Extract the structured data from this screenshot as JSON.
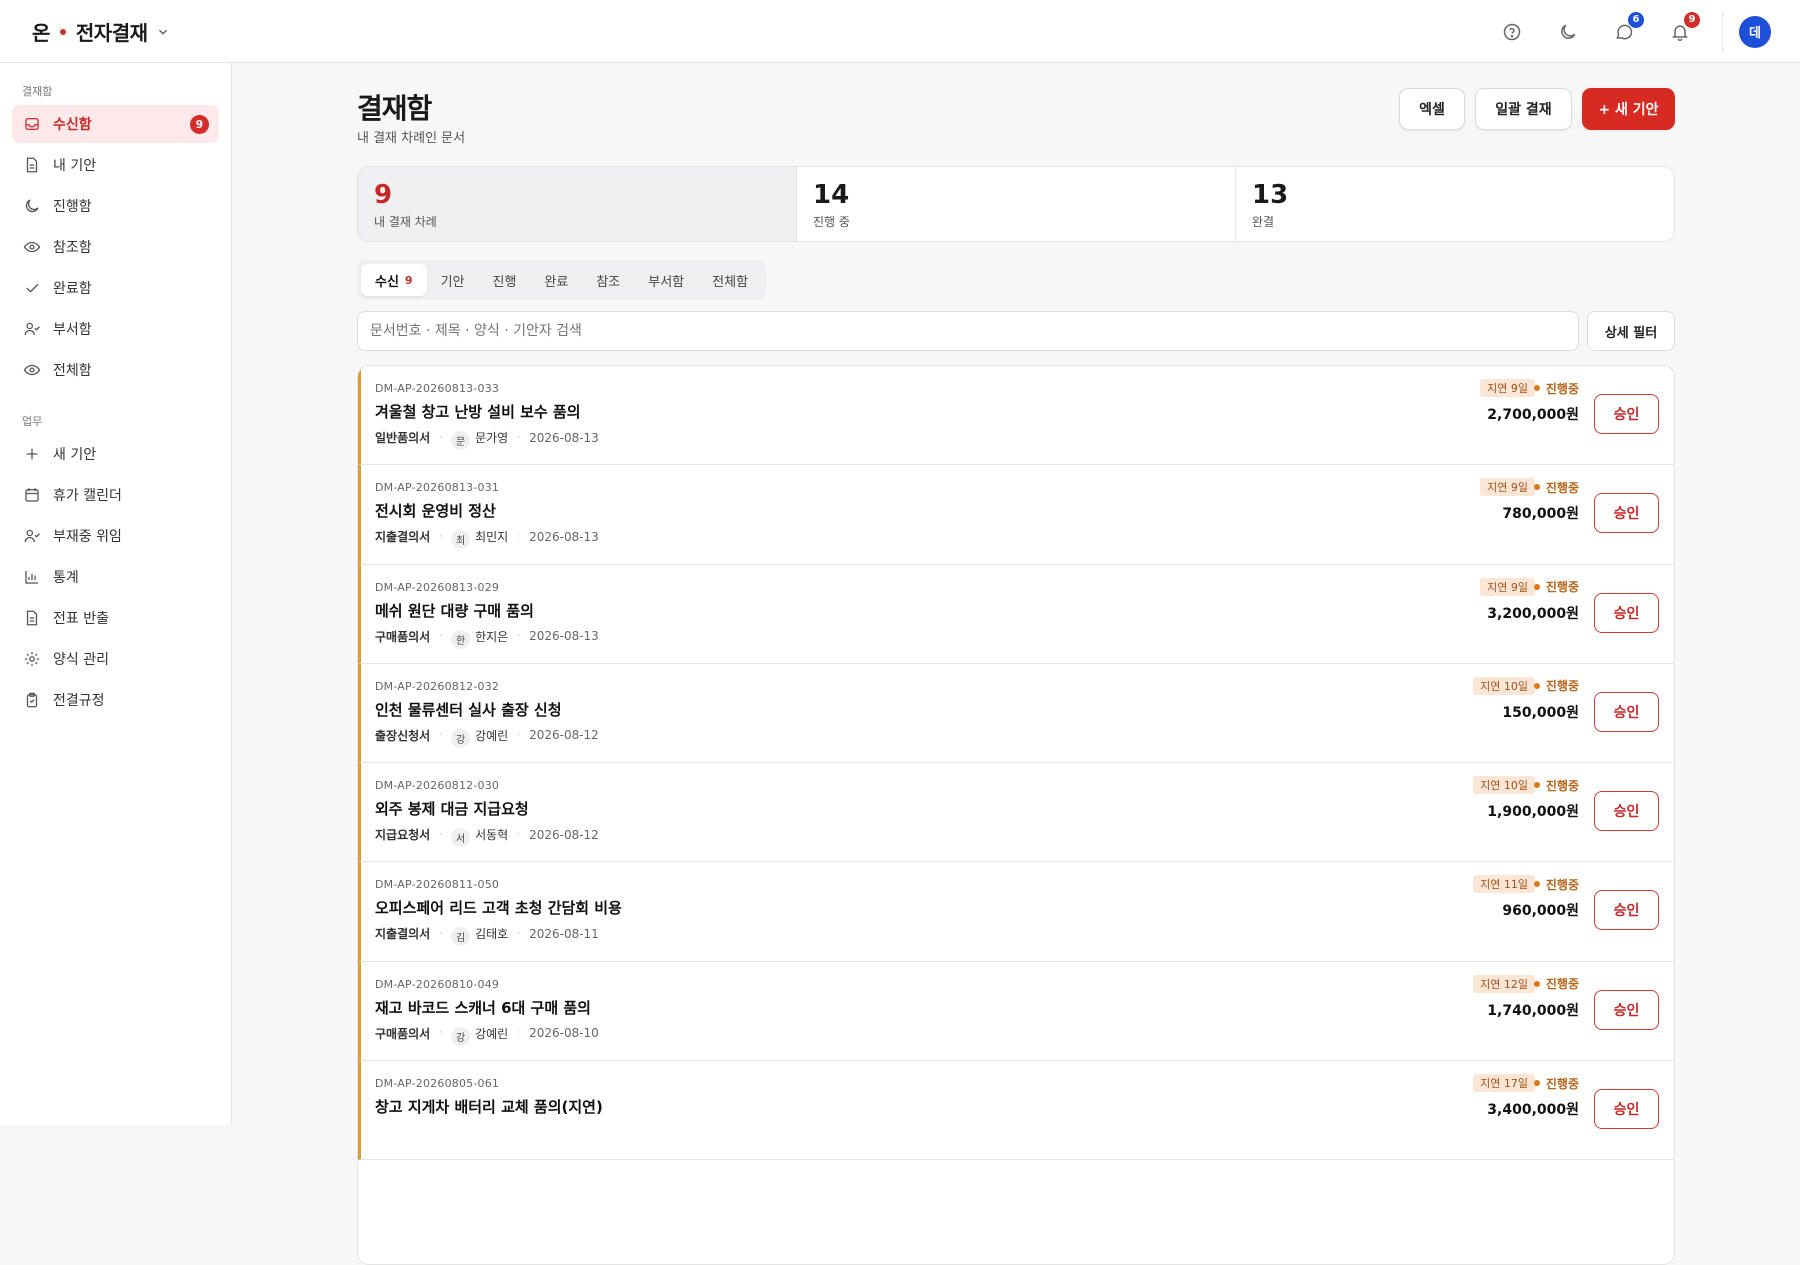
{
  "header": {
    "brand_prefix": "온",
    "brand_name": "전자결재",
    "messages_count": "6",
    "notifications_count": "9",
    "avatar_initial": "데",
    "colors": {
      "brand_red": "#d72a22",
      "avatar_blue": "#1e4fd8"
    }
  },
  "sidebar": {
    "section1_label": "결재함",
    "section1_items": [
      {
        "label": "수신함",
        "icon": "inbox-icon",
        "badge": "9",
        "active": true
      },
      {
        "label": "내 기안",
        "icon": "document-icon"
      },
      {
        "label": "진행함",
        "icon": "moon-icon"
      },
      {
        "label": "참조함",
        "icon": "eye-icon"
      },
      {
        "label": "완료함",
        "icon": "check-icon"
      },
      {
        "label": "부서함",
        "icon": "user-check-icon"
      },
      {
        "label": "전체함",
        "icon": "eye-icon"
      }
    ],
    "section2_label": "업무",
    "section2_items": [
      {
        "label": "새 기안",
        "icon": "plus-icon"
      },
      {
        "label": "휴가 캘린더",
        "icon": "calendar-icon"
      },
      {
        "label": "부재중 위임",
        "icon": "user-check-icon"
      },
      {
        "label": "통계",
        "icon": "bar-chart-icon"
      },
      {
        "label": "전표 반출",
        "icon": "document-icon"
      },
      {
        "label": "양식 관리",
        "icon": "gear-icon"
      },
      {
        "label": "전결규정",
        "icon": "clipboard-icon"
      }
    ]
  },
  "main": {
    "title": "결재함",
    "subtitle": "내 결재 차례인 문서",
    "actions": {
      "excel": "엑셀",
      "bulk": "일괄 결재",
      "new": "+ 새 기안"
    },
    "stats": [
      {
        "value": "9",
        "label": "내 결재 차례"
      },
      {
        "value": "14",
        "label": "진행 중"
      },
      {
        "value": "13",
        "label": "완결"
      }
    ],
    "tabs": [
      {
        "label": "수신",
        "count": "9"
      },
      {
        "label": "기안"
      },
      {
        "label": "진행"
      },
      {
        "label": "완료"
      },
      {
        "label": "참조"
      },
      {
        "label": "부서함"
      },
      {
        "label": "전체함"
      }
    ],
    "search_placeholder": "문서번호 · 제목 · 양식 · 기안자 검색",
    "filter_label": "상세 필터",
    "approve_label": "승인",
    "rows": [
      {
        "docno": "DM-AP-20260813-033",
        "title": "겨울철 창고 난방 설비 보수 품의",
        "form": "일반품의서",
        "initial": "문",
        "name": "문가영",
        "date": "2026-08-13",
        "delay": "지연 9일",
        "status": "진행중",
        "amount": "2,700,000원"
      },
      {
        "docno": "DM-AP-20260813-031",
        "title": "전시회 운영비 정산",
        "form": "지출결의서",
        "initial": "최",
        "name": "최민지",
        "date": "2026-08-13",
        "delay": "지연 9일",
        "status": "진행중",
        "amount": "780,000원"
      },
      {
        "docno": "DM-AP-20260813-029",
        "title": "메쉬 원단 대량 구매 품의",
        "form": "구매품의서",
        "initial": "한",
        "name": "한지은",
        "date": "2026-08-13",
        "delay": "지연 9일",
        "status": "진행중",
        "amount": "3,200,000원"
      },
      {
        "docno": "DM-AP-20260812-032",
        "title": "인천 물류센터 실사 출장 신청",
        "form": "출장신청서",
        "initial": "강",
        "name": "강예린",
        "date": "2026-08-12",
        "delay": "지연 10일",
        "status": "진행중",
        "amount": "150,000원"
      },
      {
        "docno": "DM-AP-20260812-030",
        "title": "외주 봉제 대금 지급요청",
        "form": "지급요청서",
        "initial": "서",
        "name": "서동혁",
        "date": "2026-08-12",
        "delay": "지연 10일",
        "status": "진행중",
        "amount": "1,900,000원"
      },
      {
        "docno": "DM-AP-20260811-050",
        "title": "오피스페어 리드 고객 초청 간담회 비용",
        "form": "지출결의서",
        "initial": "김",
        "name": "김태호",
        "date": "2026-08-11",
        "delay": "지연 11일",
        "status": "진행중",
        "amount": "960,000원"
      },
      {
        "docno": "DM-AP-20260810-049",
        "title": "재고 바코드 스캐너 6대 구매 품의",
        "form": "구매품의서",
        "initial": "강",
        "name": "강예린",
        "date": "2026-08-10",
        "delay": "지연 12일",
        "status": "진행중",
        "amount": "1,740,000원"
      },
      {
        "docno": "DM-AP-20260805-061",
        "title": "창고 지게차 배터리 교체 품의(지연)",
        "form": "",
        "initial": "",
        "name": "",
        "date": "",
        "delay": "지연 17일",
        "status": "진행중",
        "amount": "3,400,000원"
      }
    ]
  }
}
